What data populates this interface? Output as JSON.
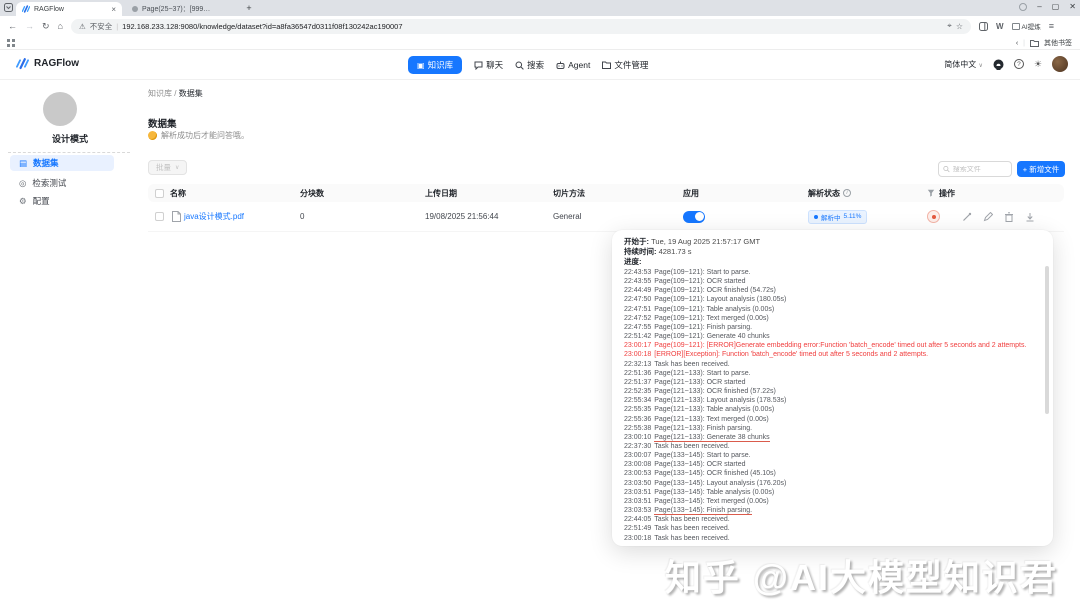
{
  "browser": {
    "active_tab_title": "RAGFlow",
    "inactive_tab_title": "Page(25~37)：[999…",
    "new_tab_label": "+",
    "security_label": "不安全",
    "url": "192.168.233.128:9080/knowledge/dataset?id=a8fa36547d0311f08f130242ac190007",
    "extension_label": "AI提炼",
    "other_bookmarks_label": "其他书签",
    "window_controls": {
      "minimize": "–",
      "maximize": "▢",
      "close": "✕"
    }
  },
  "header": {
    "logo_text": "RAGFlow",
    "nav": {
      "knowledge": "知识库",
      "chat": "聊天",
      "search": "搜索",
      "agent": "Agent",
      "files": "文件管理"
    },
    "language": "简体中文"
  },
  "sidebar": {
    "workspace_name": "设计模式",
    "items": {
      "dataset": "数据集",
      "retrieval_test": "检索测试",
      "config": "配置"
    }
  },
  "main": {
    "breadcrumb_root": "知识库",
    "breadcrumb_sep": "/",
    "breadcrumb_current": "数据集",
    "title": "数据集",
    "subtitle": "解析成功后才能问答哦。",
    "toolbar": {
      "bulk": "批量",
      "search_placeholder": "搜索文件",
      "add_file": "+ 新增文件"
    },
    "table": {
      "col_name": "名称",
      "col_chunks": "分块数",
      "col_date": "上传日期",
      "col_method": "切片方法",
      "col_enabled": "应用",
      "col_status": "解析状态",
      "col_action": "操作",
      "row": {
        "name": "java设计模式.pdf",
        "chunks": "0",
        "date": "19/08/2025 21:56:44",
        "method": "General",
        "enabled": true,
        "status_text": "解析中",
        "status_progress": "5.11%"
      }
    }
  },
  "log_popup": {
    "started_label": "开始于:",
    "started_value": "Tue, 19 Aug 2025 21:57:17 GMT",
    "duration_label": "持续时间:",
    "duration_value": "4281.73 s",
    "progress_label": "进度:",
    "lines": [
      {
        "time": "22:43:53",
        "text": "Page(109~121): Start to parse."
      },
      {
        "time": "22:43:55",
        "text": "Page(109~121): OCR started"
      },
      {
        "time": "22:44:49",
        "text": "Page(109~121): OCR finished (54.72s)"
      },
      {
        "time": "22:47:50",
        "text": "Page(109~121): Layout analysis (180.05s)"
      },
      {
        "time": "22:47:51",
        "text": "Page(109~121): Table analysis (0.00s)"
      },
      {
        "time": "22:47:52",
        "text": "Page(109~121): Text merged (0.00s)"
      },
      {
        "time": "22:47:55",
        "text": "Page(109~121): Finish parsing."
      },
      {
        "time": "22:51:42",
        "text": "Page(109~121): Generate 40 chunks"
      },
      {
        "time": "23:00:17",
        "text": "Page(109~121): [ERROR]Generate embedding error:Function 'batch_encode' timed out after 5 seconds and 2 attempts.",
        "error": true
      },
      {
        "time": "23:00:18",
        "text": "[ERROR][Exception]: Function 'batch_encode' timed out after 5 seconds and 2 attempts.",
        "error": true
      },
      {
        "time": "22:32:13",
        "text": "Task has been received."
      },
      {
        "time": "22:51:36",
        "text": "Page(121~133): Start to parse."
      },
      {
        "time": "22:51:37",
        "text": "Page(121~133): OCR started"
      },
      {
        "time": "22:52:35",
        "text": "Page(121~133): OCR finished (57.22s)"
      },
      {
        "time": "22:55:34",
        "text": "Page(121~133): Layout analysis (178.53s)"
      },
      {
        "time": "22:55:35",
        "text": "Page(121~133): Table analysis (0.00s)"
      },
      {
        "time": "22:55:36",
        "text": "Page(121~133): Text merged (0.00s)"
      },
      {
        "time": "22:55:38",
        "text": "Page(121~133): Finish parsing."
      },
      {
        "time": "23:00:10",
        "text": "Page(121~133): Generate 38 chunks",
        "underline": true
      },
      {
        "time": "22:37:30",
        "text": "Task has been received."
      },
      {
        "time": "23:00:07",
        "text": "Page(133~145): Start to parse."
      },
      {
        "time": "23:00:08",
        "text": "Page(133~145): OCR started"
      },
      {
        "time": "23:00:53",
        "text": "Page(133~145): OCR finished (45.10s)"
      },
      {
        "time": "23:03:50",
        "text": "Page(133~145): Layout analysis (176.20s)"
      },
      {
        "time": "23:03:51",
        "text": "Page(133~145): Table analysis (0.00s)"
      },
      {
        "time": "23:03:51",
        "text": "Page(133~145): Text merged (0.00s)"
      },
      {
        "time": "23:03:53",
        "text": "Page(133~145): Finish parsing.",
        "underline": true
      },
      {
        "time": "22:44:05",
        "text": "Task has been received."
      },
      {
        "time": "22:51:49",
        "text": "Task has been received."
      },
      {
        "time": "23:00:18",
        "text": "Task has been received."
      }
    ]
  },
  "watermark": "知乎 @AI大模型知识君",
  "colors": {
    "accent": "#1677ff",
    "error": "#f03e3e",
    "annotation": "#d33e2d"
  },
  "icons": {
    "chevron_down": "∨",
    "back": "←",
    "forward": "→",
    "reload": "↻",
    "home": "⌂",
    "warning": "⚠",
    "star": "☆",
    "pin": "⌖",
    "menu": "≡",
    "sun": "☀",
    "gear": "⚙",
    "doc": "▤",
    "target": "◎",
    "book": "▣",
    "divider": "|",
    "back_chevron": "‹"
  }
}
